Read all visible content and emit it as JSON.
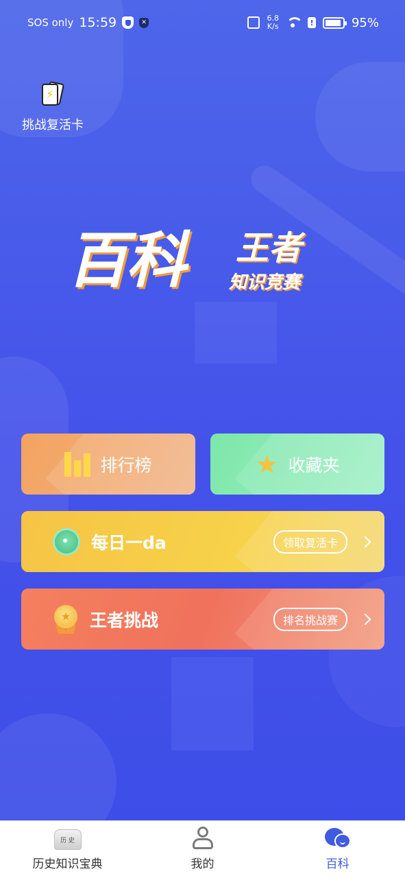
{
  "status_bar": {
    "carrier": "SOS only",
    "time": "15:59",
    "net_speed_value": "6.8",
    "net_speed_unit": "K/s",
    "battery": "95%"
  },
  "revive_card": {
    "label": "挑战复活卡"
  },
  "logo": {
    "main": "百科",
    "sub_top": "王者",
    "sub_bottom": "知识竞赛"
  },
  "menu": {
    "leaderboard": {
      "label": "排行榜",
      "icon": "bar-chart-icon",
      "color": "#f3a35f"
    },
    "favorites": {
      "label": "收藏夹",
      "icon": "star-icon",
      "color": "#7ce7a9"
    },
    "daily": {
      "title": "每日一da",
      "action": "领取复活卡",
      "icon": "orb-icon",
      "color": "#f6c445"
    },
    "king": {
      "title": "王者挑战",
      "action": "排名挑战赛",
      "icon": "medal-icon",
      "color": "#f4805e"
    }
  },
  "tabbar": {
    "items": [
      {
        "label": "历史知识宝典",
        "icon": "book-icon",
        "icon_text": "历 史"
      },
      {
        "label": "我的",
        "icon": "user-icon"
      },
      {
        "label": "百科",
        "icon": "chat-bubble-icon",
        "active": true
      }
    ],
    "active_color": "#3f5be0"
  },
  "theme": {
    "background": "#4452ea"
  }
}
